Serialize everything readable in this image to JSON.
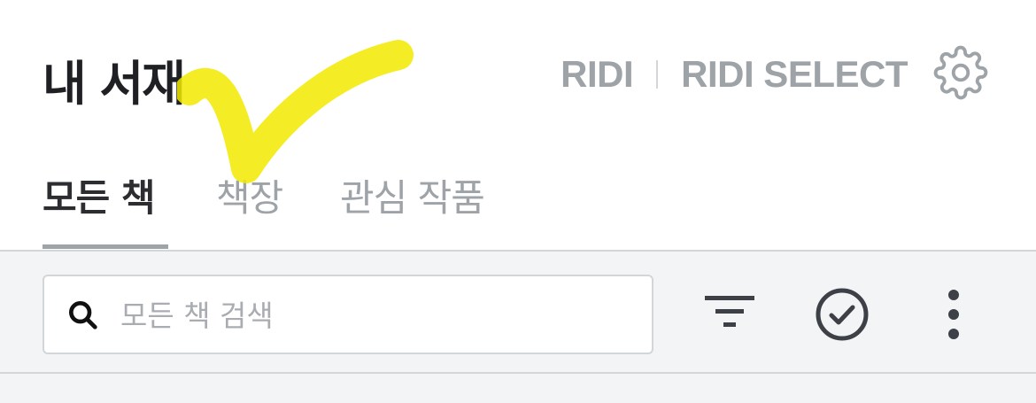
{
  "header": {
    "title": "내 서재",
    "service_links": [
      "RIDI",
      "RIDI SELECT"
    ]
  },
  "icons": {
    "settings": "gear-icon",
    "search": "search-icon",
    "filter": "filter-icon",
    "select": "check-circle-icon",
    "more": "more-vertical-icon",
    "highlight": "yellow-checkmark-annotation"
  },
  "tabs": [
    {
      "label": "모든 책",
      "active": true
    },
    {
      "label": "책장",
      "active": false
    },
    {
      "label": "관심 작품",
      "active": false
    }
  ],
  "search": {
    "placeholder": "모든 책 검색",
    "value": ""
  },
  "colors": {
    "title": "#1f2023",
    "muted": "#9ea3a8",
    "toolbar_bg": "#f3f4f5",
    "border": "#d3d6d9",
    "icon": "#3d4047",
    "highlight": "#f2ea00"
  }
}
